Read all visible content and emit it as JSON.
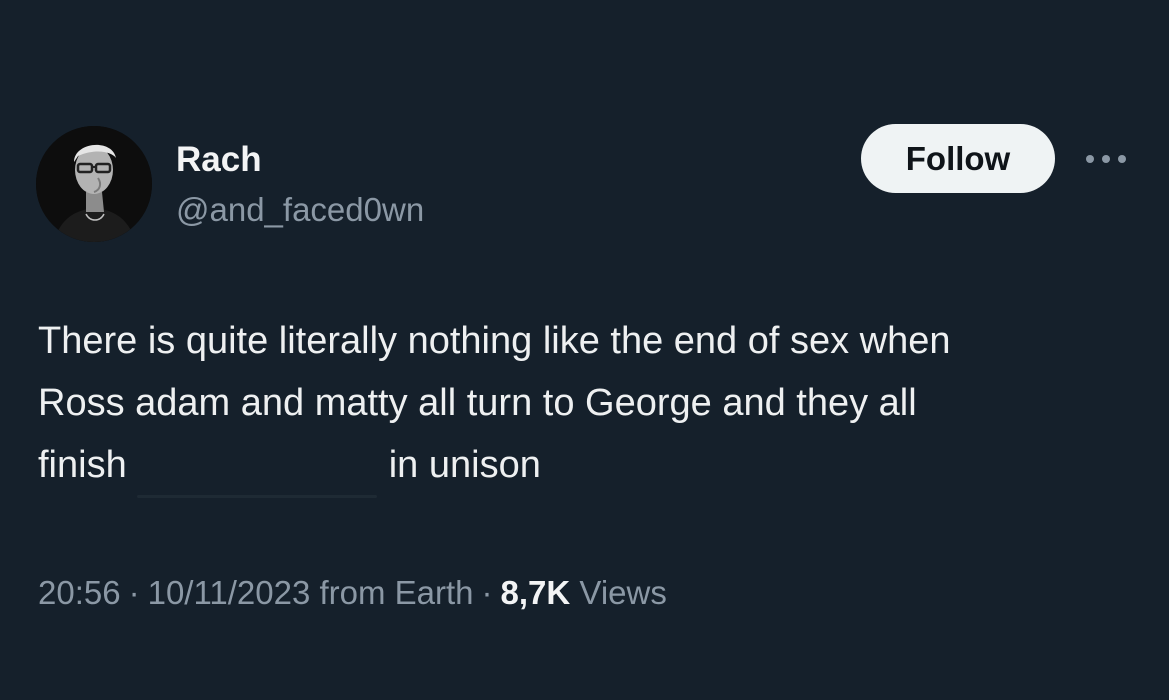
{
  "author": {
    "name": "Rach",
    "handle": "@and_faced0wn",
    "avatar": "profile-photo-avatar"
  },
  "actions": {
    "follow_label": "Follow",
    "more_icon": "more-horizontal-icon"
  },
  "tweet": {
    "line1": "There is quite literally nothing like the end of sex when",
    "line2": "Ross adam and matty all turn to George and they all",
    "line3_start": "finish",
    "line3_end": "in unison"
  },
  "meta": {
    "time": "20:56",
    "date": "10/11/2023",
    "source": "from Earth",
    "separator": "·",
    "views_count": "8,7K",
    "views_label": "Views"
  },
  "colors": {
    "background": "#15202b",
    "primary_text": "#e7e9ea",
    "secondary_text": "#8b98a5",
    "follow_button_bg": "#eff3f4",
    "follow_button_text": "#0f1419"
  }
}
